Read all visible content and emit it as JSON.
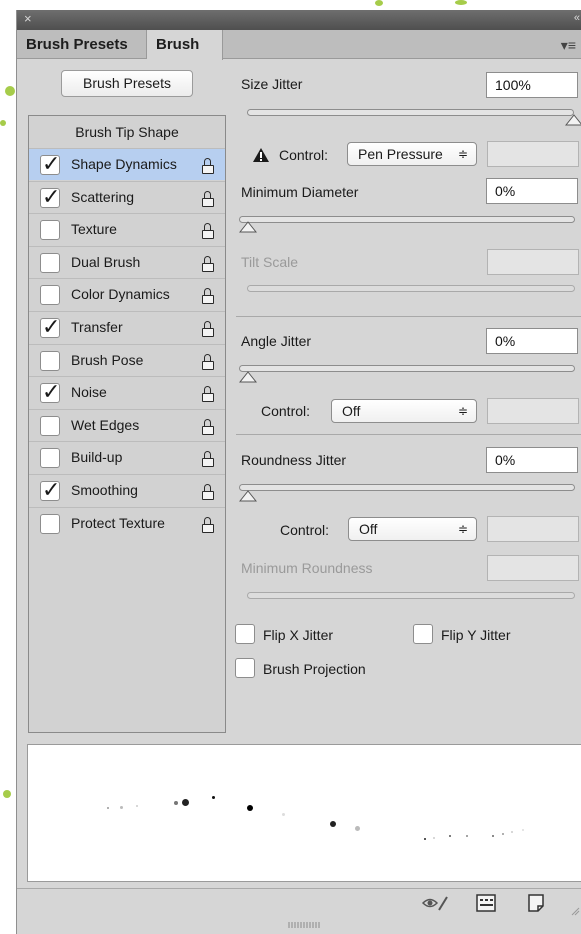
{
  "window": {
    "close_glyph": "×",
    "collapse_glyph": "«"
  },
  "tabs": [
    {
      "label": "Brush Presets",
      "active": false
    },
    {
      "label": "Brush",
      "active": true
    }
  ],
  "panel_menu_icon": "≡",
  "brush_presets_button": "Brush Presets",
  "left_list": {
    "header": "Brush Tip Shape",
    "items": [
      {
        "label": "Shape Dynamics",
        "checked": true,
        "selected": true
      },
      {
        "label": "Scattering",
        "checked": true,
        "selected": false
      },
      {
        "label": "Texture",
        "checked": false,
        "selected": false
      },
      {
        "label": "Dual Brush",
        "checked": false,
        "selected": false
      },
      {
        "label": "Color Dynamics",
        "checked": false,
        "selected": false
      },
      {
        "label": "Transfer",
        "checked": true,
        "selected": false
      },
      {
        "label": "Brush Pose",
        "checked": false,
        "selected": false
      },
      {
        "label": "Noise",
        "checked": true,
        "selected": false
      },
      {
        "label": "Wet Edges",
        "checked": false,
        "selected": false
      },
      {
        "label": "Build-up",
        "checked": false,
        "selected": false
      },
      {
        "label": "Smoothing",
        "checked": true,
        "selected": false
      },
      {
        "label": "Protect Texture",
        "checked": false,
        "selected": false
      }
    ]
  },
  "settings": {
    "size_jitter": {
      "label": "Size Jitter",
      "value": "100%",
      "slider_fraction": 1.0
    },
    "size_control": {
      "label": "Control:",
      "value": "Pen Pressure",
      "warning": true
    },
    "minimum_diameter": {
      "label": "Minimum Diameter",
      "value": "0%",
      "slider_fraction": 0.0
    },
    "tilt_scale": {
      "label": "Tilt Scale",
      "value": "",
      "disabled": true
    },
    "angle_jitter": {
      "label": "Angle Jitter",
      "value": "0%",
      "slider_fraction": 0.0
    },
    "angle_control": {
      "label": "Control:",
      "value": "Off"
    },
    "roundness_jitter": {
      "label": "Roundness Jitter",
      "value": "0%",
      "slider_fraction": 0.0
    },
    "roundness_control": {
      "label": "Control:",
      "value": "Off"
    },
    "minimum_roundness": {
      "label": "Minimum Roundness",
      "value": "",
      "disabled": true
    },
    "flip_x": {
      "label": "Flip X Jitter",
      "checked": false
    },
    "flip_y": {
      "label": "Flip Y Jitter",
      "checked": false
    },
    "brush_projection": {
      "label": "Brush Projection",
      "checked": false
    }
  },
  "bottom_icons": [
    "eye-brush-icon",
    "new-preset-grid-icon",
    "new-brush-page-icon"
  ],
  "colors": {
    "selected_row": "#b7cff0",
    "panel_bg": "#d6d6d6",
    "accent_splash": "#a6cc4a"
  }
}
